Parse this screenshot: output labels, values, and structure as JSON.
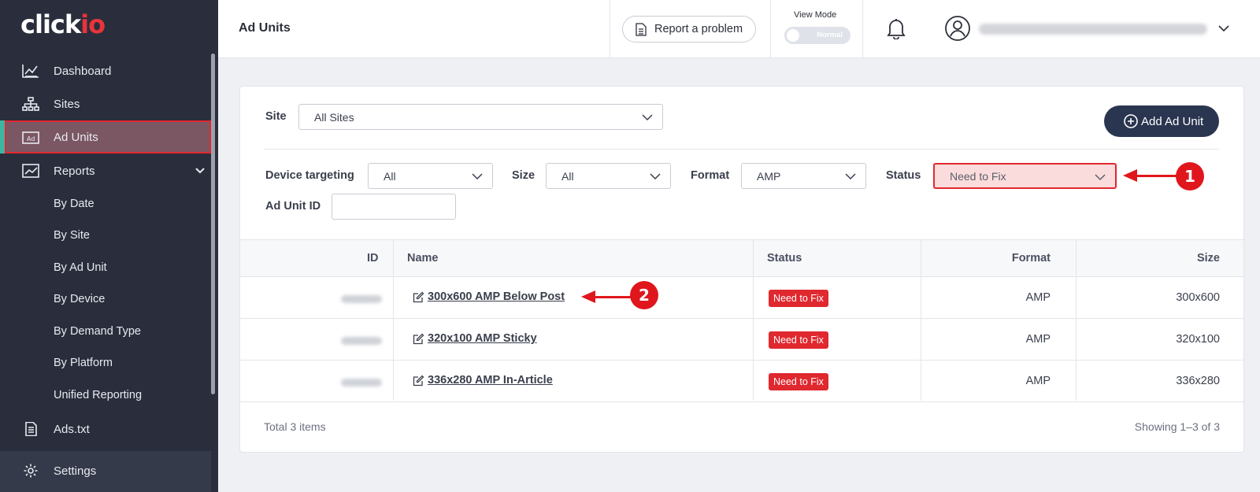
{
  "app": {
    "logo_text": "click",
    "logo_accent": "io",
    "brand_color": "#e8343a"
  },
  "sidebar": {
    "items": [
      {
        "label": "Dashboard",
        "icon": "dashboard-chart-icon"
      },
      {
        "label": "Sites",
        "icon": "sitemap-icon"
      },
      {
        "label": "Ad Units",
        "icon": "ad-icon",
        "active": true
      },
      {
        "label": "Reports",
        "icon": "reports-chart-icon",
        "expanded": true
      },
      {
        "label": "Ads.txt",
        "icon": "document-icon"
      },
      {
        "label": "Settings",
        "icon": "gear-icon"
      }
    ],
    "reports_sub": [
      "By Date",
      "By Site",
      "By Ad Unit",
      "By Device",
      "By Demand Type",
      "By Platform",
      "Unified Reporting"
    ]
  },
  "header": {
    "title": "Ad Units",
    "report_button": "Report a problem",
    "view_mode_label": "View Mode",
    "view_mode_value": "Normal"
  },
  "filters": {
    "site_label": "Site",
    "site_value": "All Sites",
    "add_button": "Add Ad Unit",
    "device_label": "Device targeting",
    "device_value": "All",
    "size_label": "Size",
    "size_value": "All",
    "format_label": "Format",
    "format_value": "AMP",
    "status_label": "Status",
    "status_value": "Need to Fix",
    "adunit_id_label": "Ad Unit ID",
    "adunit_id_value": ""
  },
  "table": {
    "headers": {
      "id": "ID",
      "name": "Name",
      "status": "Status",
      "format": "Format",
      "size": "Size"
    },
    "rows": [
      {
        "name": "300x600 AMP Below Post",
        "status": "Need to Fix",
        "format": "AMP",
        "size": "300x600"
      },
      {
        "name": "320x100 AMP Sticky",
        "status": "Need to Fix",
        "format": "AMP",
        "size": "320x100"
      },
      {
        "name": "336x280 AMP In-Article",
        "status": "Need to Fix",
        "format": "AMP",
        "size": "336x280"
      }
    ],
    "total_text": "Total 3 items",
    "showing_text": "Showing 1–3 of 3"
  },
  "annotations": {
    "callout_1": "1",
    "callout_2": "2",
    "annotation_color": "#e0161d"
  }
}
